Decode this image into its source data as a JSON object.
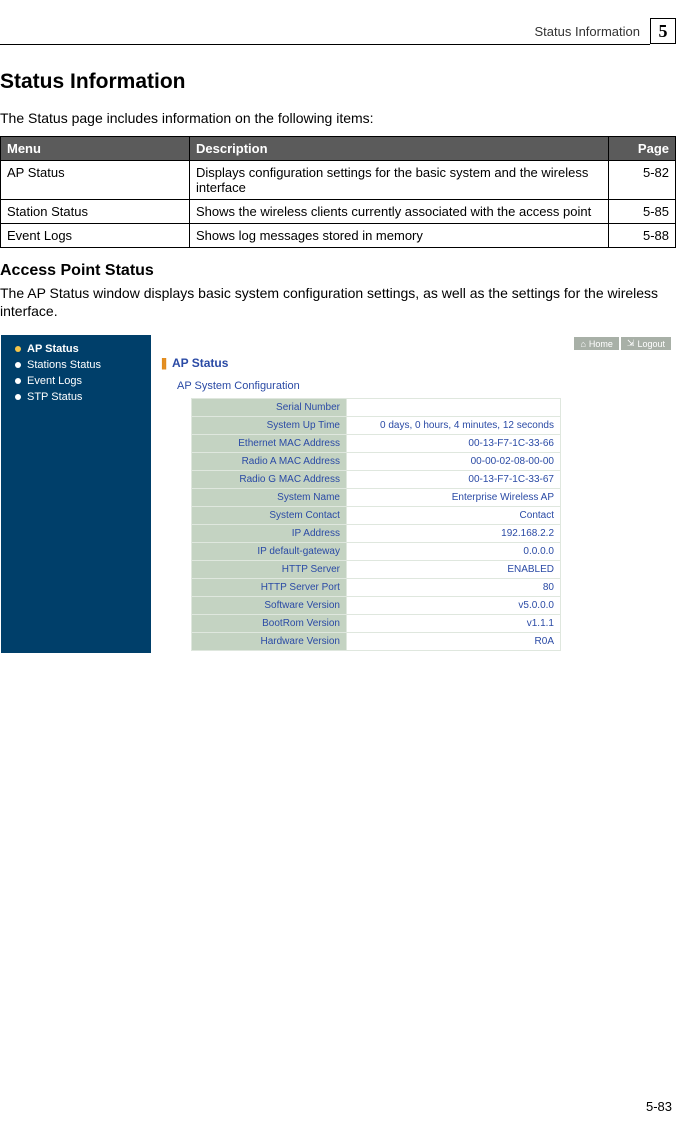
{
  "header": {
    "section": "Status Information",
    "chapter": "5"
  },
  "h1": "Status Information",
  "intro": "The Status page includes information on the following items:",
  "menu_table": {
    "headers": [
      "Menu",
      "Description",
      "Page"
    ],
    "rows": [
      {
        "menu": "AP Status",
        "desc": "Displays configuration settings for the basic system and the wireless interface",
        "page": "5-82"
      },
      {
        "menu": "Station Status",
        "desc": "Shows the wireless clients currently associated with the access point",
        "page": "5-85"
      },
      {
        "menu": "Event Logs",
        "desc": "Shows log messages stored in memory",
        "page": "5-88"
      }
    ]
  },
  "h2": "Access Point Status",
  "sub_intro": "The AP Status window displays basic system configuration settings, as well as the settings for the wireless interface.",
  "screenshot": {
    "sidebar": {
      "items": [
        {
          "label": "AP Status",
          "active": true
        },
        {
          "label": "Stations Status",
          "active": false
        },
        {
          "label": "Event Logs",
          "active": false
        },
        {
          "label": "STP Status",
          "active": false
        }
      ]
    },
    "topbar": {
      "home": "Home",
      "logout": "Logout"
    },
    "panel_title": "AP Status",
    "section_title": "AP System Configuration",
    "rows": [
      {
        "label": "Serial Number",
        "value": ""
      },
      {
        "label": "System Up Time",
        "value": "0 days, 0 hours, 4 minutes, 12 seconds"
      },
      {
        "label": "Ethernet MAC Address",
        "value": "00-13-F7-1C-33-66"
      },
      {
        "label": "Radio A MAC Address",
        "value": "00-00-02-08-00-00"
      },
      {
        "label": "Radio G MAC Address",
        "value": "00-13-F7-1C-33-67"
      },
      {
        "label": "System Name",
        "value": "Enterprise Wireless AP"
      },
      {
        "label": "System Contact",
        "value": "Contact"
      },
      {
        "label": "IP Address",
        "value": "192.168.2.2"
      },
      {
        "label": "IP default-gateway",
        "value": "0.0.0.0"
      },
      {
        "label": "HTTP Server",
        "value": "ENABLED"
      },
      {
        "label": "HTTP Server Port",
        "value": "80"
      },
      {
        "label": "Software Version",
        "value": "v5.0.0.0"
      },
      {
        "label": "BootRom Version",
        "value": "v1.1.1"
      },
      {
        "label": "Hardware Version",
        "value": "R0A"
      }
    ]
  },
  "page_num": "5-83"
}
